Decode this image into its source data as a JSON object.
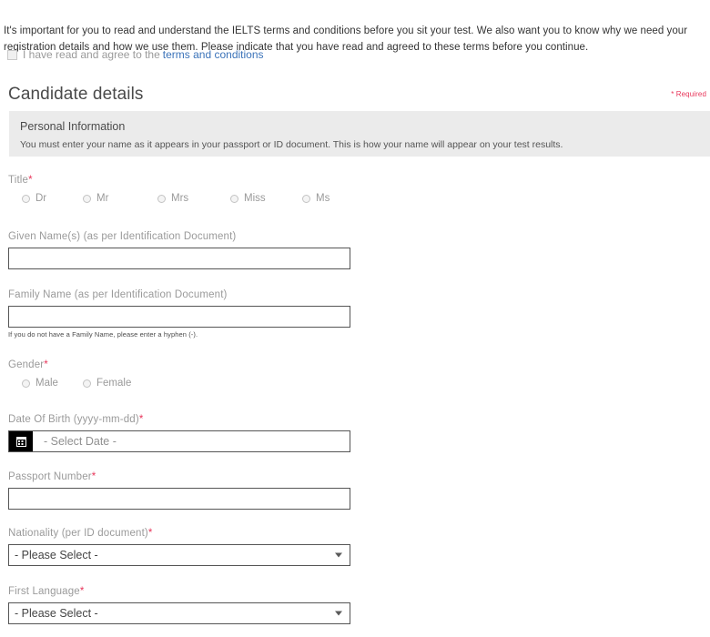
{
  "intro": {
    "paragraph": "It's important for you to read and understand the IELTS terms and conditions before you sit your test. We also want you to know why we need your registration details and how we use them. Please indicate that you have read and agreed to these terms before you continue."
  },
  "agreement": {
    "checkbox_checked": false,
    "label": "I have read and agree to the",
    "link_text": "terms and conditions",
    "link_color": "#3b73b9"
  },
  "heading": "Candidate details",
  "required_note": "* Required",
  "required_color": "#e8365a",
  "panel": {
    "title": "Personal Information",
    "description": "You must enter your name as it appears in your passport or ID document. This is how your name will appear on your test results.",
    "background": "#ebebeb"
  },
  "fields": {
    "title": {
      "label": "Title",
      "required": true,
      "options": [
        "Dr",
        "Mr",
        "Mrs",
        "Miss",
        "Ms"
      ],
      "selected": ""
    },
    "given_name": {
      "label": "Given Name(s) (as per Identification Document)",
      "required": false,
      "value": "",
      "placeholder": ""
    },
    "family_name": {
      "label": "Family Name (as per Identification Document)",
      "required": false,
      "value": "",
      "placeholder": "",
      "hint": "If you do not have a Family Name, please enter a hyphen (-)."
    },
    "gender": {
      "label": "Gender",
      "required": true,
      "options": [
        "Male",
        "Female"
      ],
      "selected": ""
    },
    "date_of_birth": {
      "label": "Date Of Birth (yyyy-mm-dd)",
      "required": true,
      "value": "- Select Date -",
      "icon": "calendar-icon"
    },
    "passport_number": {
      "label": "Passport Number",
      "required": true,
      "value": "",
      "placeholder": ""
    },
    "nationality": {
      "label": "Nationality (per ID document)",
      "required": true,
      "selected": "- Please Select -"
    },
    "first_language": {
      "label": "First Language",
      "required": true,
      "selected": "- Please Select -"
    }
  }
}
